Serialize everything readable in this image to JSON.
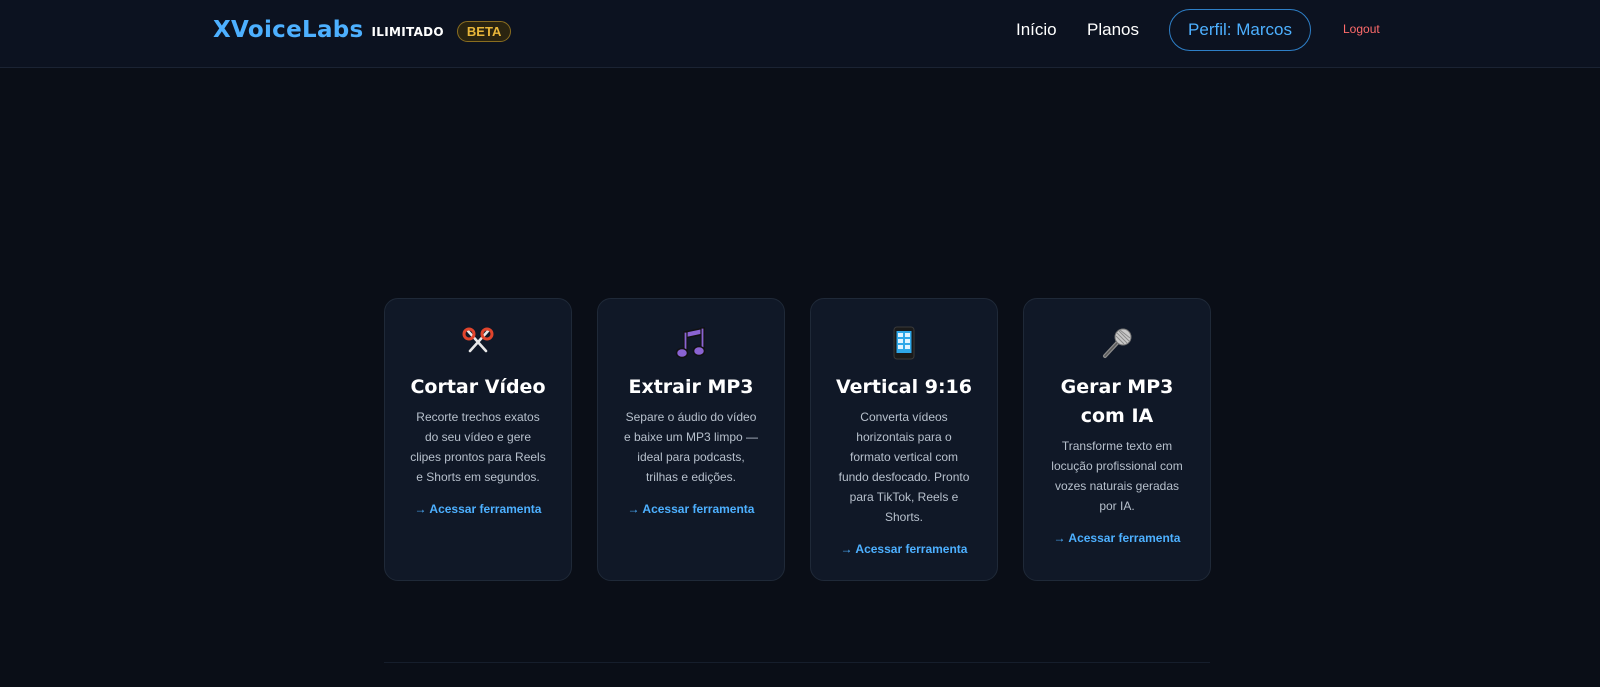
{
  "header": {
    "brand_name": "XVoiceLabs",
    "brand_tag": "ILIMITADO",
    "beta_label": "BETA",
    "nav": {
      "inicio": "Início",
      "planos": "Planos",
      "profile": "Perfil: Marcos",
      "logout": "Logout"
    }
  },
  "tools": [
    {
      "icon": "scissors-icon",
      "title": "Cortar Vídeo",
      "description": "Recorte trechos exatos do seu vídeo e gere clipes prontos para Reels e Shorts em segundos.",
      "link": "→ Acessar ferramenta"
    },
    {
      "icon": "music-note-icon",
      "title": "Extrair MP3",
      "description": "Separe o áudio do vídeo e baixe um MP3 limpo — ideal para podcasts, trilhas e edições.",
      "link": "→ Acessar ferramenta"
    },
    {
      "icon": "mobile-phone-icon",
      "title": "Vertical 9:16",
      "description": "Converta vídeos horizontais para o formato vertical com fundo desfocado. Pronto para TikTok, Reels e Shorts.",
      "link": "→ Acessar ferramenta"
    },
    {
      "icon": "microphone-icon",
      "title": "Gerar MP3 com IA",
      "description": "Transforme texto em locução profissional com vozes naturais geradas por IA.",
      "link": "→ Acessar ferramenta"
    }
  ],
  "colors": {
    "background": "#0a0e17",
    "card": "#101827",
    "accent": "#4db0ff",
    "beta": "#e9b73a",
    "logout": "#ff6b6b"
  }
}
